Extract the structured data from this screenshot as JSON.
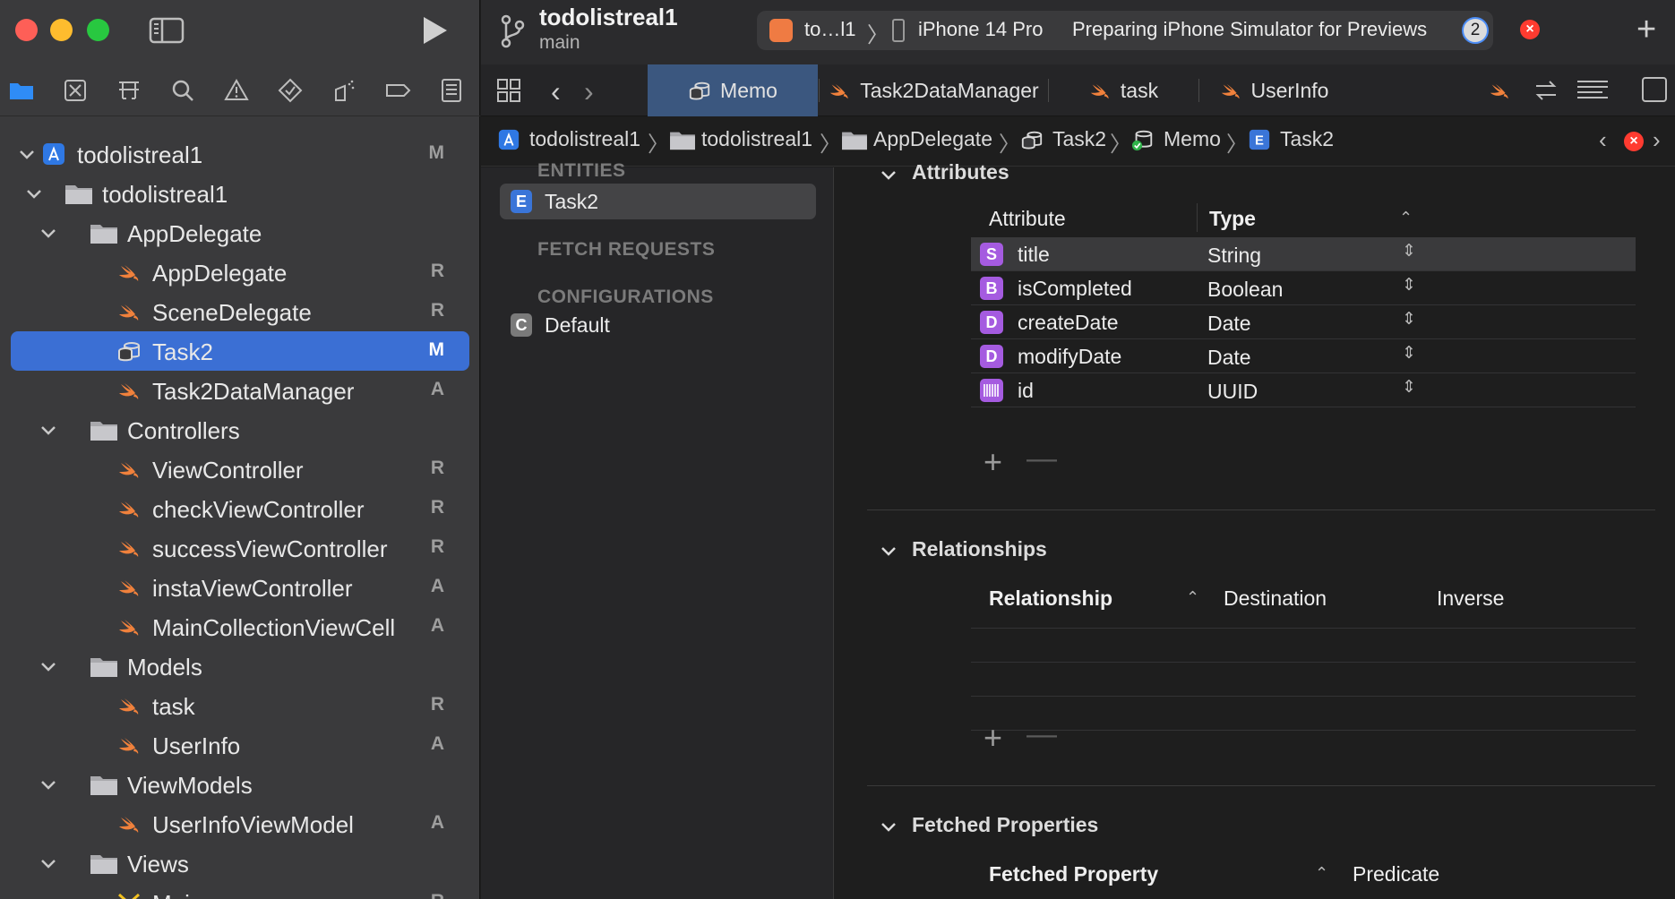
{
  "window": {
    "project_title": "todolistreal1",
    "branch": "main"
  },
  "scheme": {
    "app": "to…l1",
    "device": "iPhone 14 Pro",
    "status": "Preparing iPhone Simulator for Previews",
    "activity_count": "2"
  },
  "navigator": {
    "items": [
      {
        "label": "todolistreal1",
        "badge": "M",
        "icon": "project-icon",
        "level": 0
      },
      {
        "label": "todolistreal1",
        "badge": "",
        "icon": "folder-icon",
        "level": 1
      },
      {
        "label": "AppDelegate",
        "badge": "",
        "icon": "folder-icon",
        "level": 2
      },
      {
        "label": "AppDelegate",
        "badge": "R",
        "icon": "swift-icon",
        "level": 3
      },
      {
        "label": "SceneDelegate",
        "badge": "R",
        "icon": "swift-icon",
        "level": 3
      },
      {
        "label": "Task2",
        "badge": "M",
        "icon": "core-data-model-icon",
        "level": 3,
        "selected": true
      },
      {
        "label": "Task2DataManager",
        "badge": "A",
        "icon": "swift-icon",
        "level": 3
      },
      {
        "label": "Controllers",
        "badge": "",
        "icon": "folder-icon",
        "level": 2
      },
      {
        "label": "ViewController",
        "badge": "R",
        "icon": "swift-icon",
        "level": 3
      },
      {
        "label": "checkViewController",
        "badge": "R",
        "icon": "swift-icon",
        "level": 3
      },
      {
        "label": "successViewController",
        "badge": "R",
        "icon": "swift-icon",
        "level": 3
      },
      {
        "label": "instaViewController",
        "badge": "A",
        "icon": "swift-icon",
        "level": 3
      },
      {
        "label": "MainCollectionViewCell",
        "badge": "A",
        "icon": "swift-icon",
        "level": 3
      },
      {
        "label": "Models",
        "badge": "",
        "icon": "folder-icon",
        "level": 2
      },
      {
        "label": "task",
        "badge": "R",
        "icon": "swift-icon",
        "level": 3
      },
      {
        "label": "UserInfo",
        "badge": "A",
        "icon": "swift-icon",
        "level": 3
      },
      {
        "label": "ViewModels",
        "badge": "",
        "icon": "folder-icon",
        "level": 2
      },
      {
        "label": "UserInfoViewModel",
        "badge": "A",
        "icon": "swift-icon",
        "level": 3
      },
      {
        "label": "Views",
        "badge": "",
        "icon": "folder-icon",
        "level": 2
      },
      {
        "label": "Main",
        "badge": "R",
        "icon": "storyboard-icon",
        "level": 3
      }
    ]
  },
  "tabs": [
    {
      "label": "Memo",
      "icon": "core-data-model-icon",
      "active": true
    },
    {
      "label": "Task2DataManager",
      "icon": "swift-icon"
    },
    {
      "label": "task",
      "icon": "swift-icon"
    },
    {
      "label": "UserInfo",
      "icon": "swift-icon"
    }
  ],
  "jumpbar": [
    {
      "label": "todolistreal1",
      "icon": "project-icon"
    },
    {
      "label": "todolistreal1",
      "icon": "folder-icon"
    },
    {
      "label": "AppDelegate",
      "icon": "folder-icon"
    },
    {
      "label": "Task2",
      "icon": "core-data-model-icon"
    },
    {
      "label": "Memo",
      "icon": "core-data-version-icon"
    },
    {
      "label": "Task2",
      "icon": "entity-icon"
    }
  ],
  "entities_panel": {
    "entities_header": "ENTITIES",
    "entities": [
      {
        "badge": "E",
        "label": "Task2"
      }
    ],
    "fetch_header": "FETCH REQUESTS",
    "config_header": "CONFIGURATIONS",
    "configurations": [
      {
        "badge": "C",
        "label": "Default"
      }
    ]
  },
  "attributes": {
    "title": "Attributes",
    "col_attribute": "Attribute",
    "col_type": "Type",
    "rows": [
      {
        "badge": "S",
        "name": "title",
        "type": "String",
        "color": "#a55be0"
      },
      {
        "badge": "B",
        "name": "isCompleted",
        "type": "Boolean",
        "color": "#a55be0"
      },
      {
        "badge": "D",
        "name": "createDate",
        "type": "Date",
        "color": "#a55be0"
      },
      {
        "badge": "D",
        "name": "modifyDate",
        "type": "Date",
        "color": "#a55be0"
      },
      {
        "badge": "",
        "name": "id",
        "type": "UUID",
        "color": "#a55be0"
      }
    ]
  },
  "relationships": {
    "title": "Relationships",
    "col_relationship": "Relationship",
    "col_destination": "Destination",
    "col_inverse": "Inverse"
  },
  "fetched": {
    "title": "Fetched Properties",
    "col_property": "Fetched Property",
    "col_predicate": "Predicate"
  },
  "colors": {
    "selection": "#3b6fd4",
    "active_tab": "#3b577f",
    "swift": "#f0813c",
    "entity_badge": "#3a75d8",
    "attr_badge": "#a55be0"
  }
}
